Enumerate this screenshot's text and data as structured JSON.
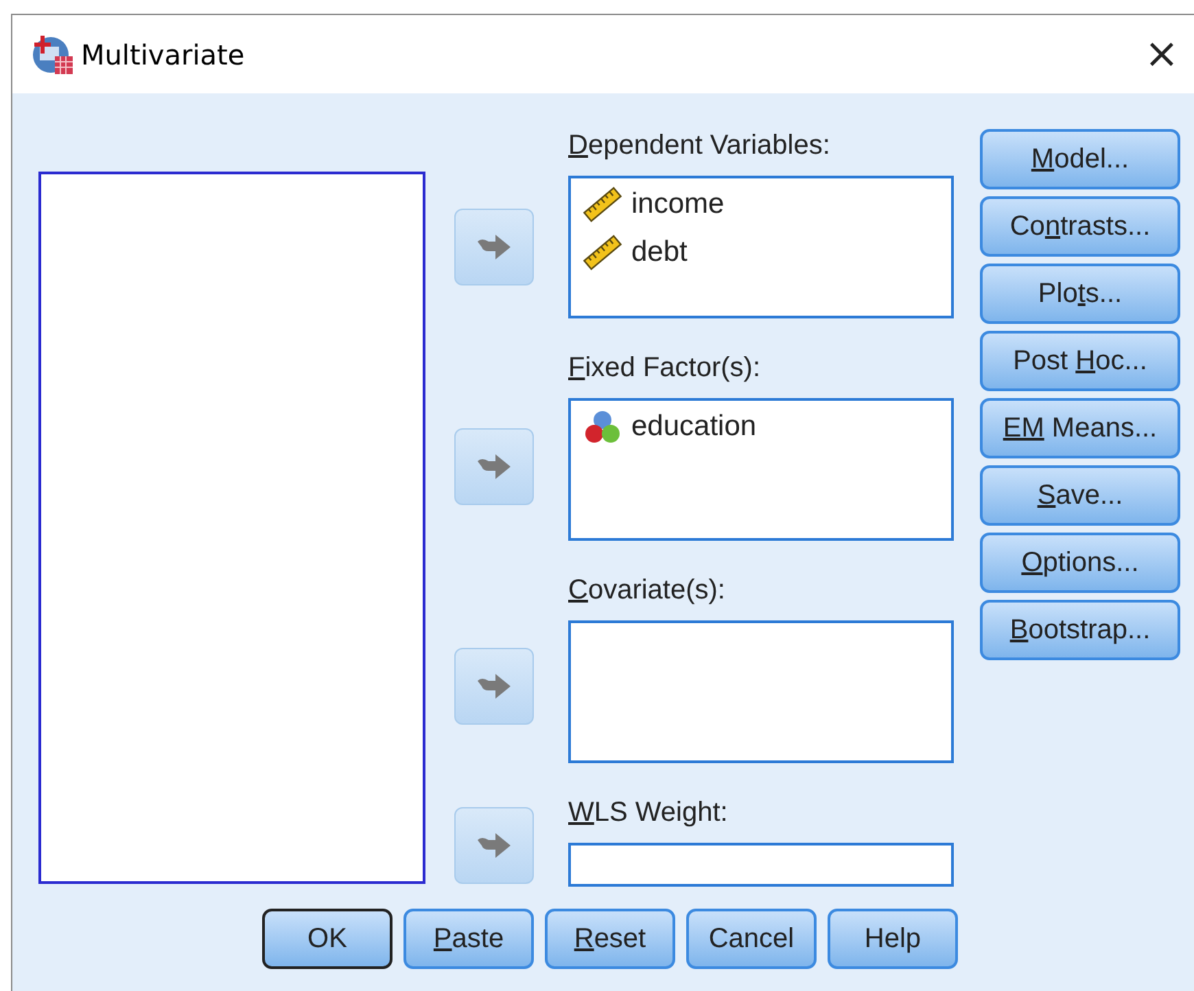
{
  "window": {
    "title": "Multivariate",
    "close": "×"
  },
  "targets": [
    {
      "kind": "list",
      "label": {
        "key": "D",
        "post": "ependent Variables:"
      },
      "arrow_disabled": true,
      "items": [
        {
          "name": "income",
          "kind": "scale"
        },
        {
          "name": "debt",
          "kind": "scale"
        }
      ]
    },
    {
      "kind": "list",
      "label": {
        "key": "F",
        "post": "ixed Factor(s):"
      },
      "arrow_disabled": true,
      "items": [
        {
          "name": "education",
          "kind": "nominal"
        }
      ]
    },
    {
      "kind": "list",
      "label": {
        "key": "C",
        "post": "ovariate(s):"
      },
      "arrow_disabled": true
    },
    {
      "kind": "field",
      "label": {
        "key": "W",
        "post": "LS Weight:"
      },
      "arrow_disabled": true
    }
  ],
  "side_buttons": [
    {
      "key": "M",
      "post": "odel..."
    },
    {
      "pre": "Co",
      "key": "n",
      "post": "trasts..."
    },
    {
      "pre": "Plo",
      "key": "t",
      "post": "s..."
    },
    {
      "pre": "Post ",
      "key": "H",
      "post": "oc..."
    },
    {
      "key": "EM",
      "post": " Means..."
    },
    {
      "key": "S",
      "post": "ave..."
    },
    {
      "key": "O",
      "post": "ptions..."
    },
    {
      "key": "B",
      "post": "ootstrap..."
    }
  ],
  "bottom_buttons": [
    {
      "pre": "OK",
      "default": true
    },
    {
      "key": "P",
      "post": "aste",
      "default": false
    },
    {
      "key": "R",
      "post": "eset",
      "default": false
    },
    {
      "pre": "Cancel",
      "default": false
    },
    {
      "pre": "Help",
      "default": false
    }
  ]
}
